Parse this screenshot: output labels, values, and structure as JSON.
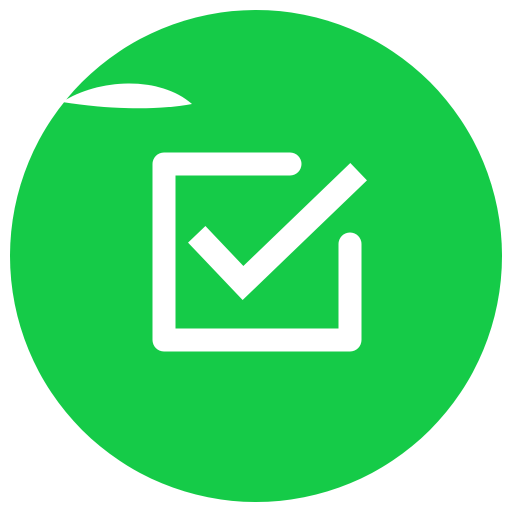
{
  "app_icon": {
    "name": "checkbox-checked-app-icon",
    "colors": {
      "background_circle": "#15CB48",
      "foreground": "#FFFFFF",
      "page_background": "#FFFFFF"
    },
    "icons": {
      "circle": "green-circle-badge",
      "checkbox": "checkbox-icon",
      "checkmark": "checkmark-icon",
      "highlight": "gloss-highlight"
    }
  }
}
